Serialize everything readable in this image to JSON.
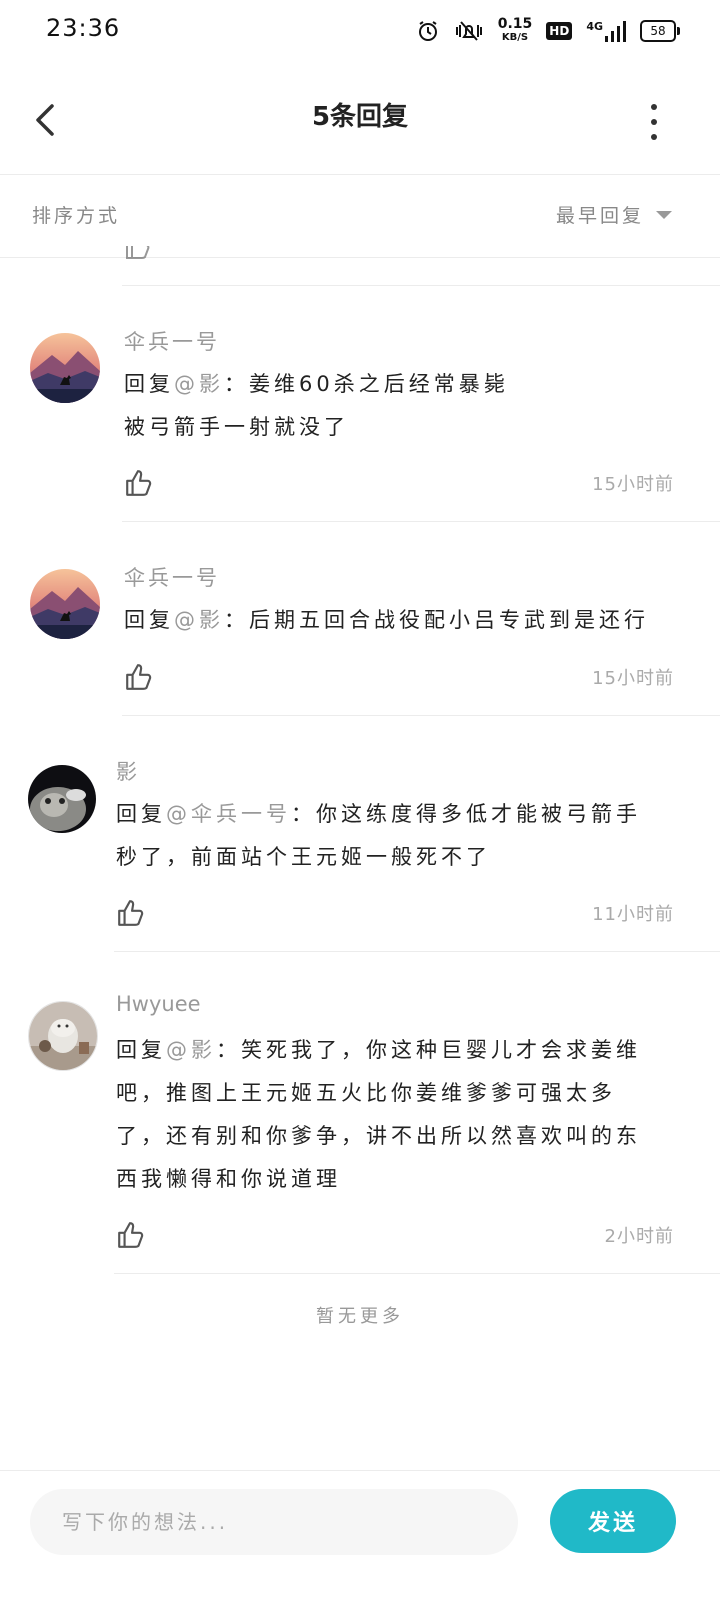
{
  "status": {
    "time": "23:36",
    "net_speed_value": "0.15",
    "net_speed_unit": "KB/S",
    "hd": "HD",
    "network": "4G",
    "battery": "58"
  },
  "header": {
    "title": "5条回复"
  },
  "sort": {
    "label": "排序方式",
    "value": "最早回复"
  },
  "replies": [
    {
      "user": "伞兵一号",
      "mention": "@影",
      "prefix": "回复",
      "text_line1": "：姜维60杀之后经常暴毙",
      "text_line2": "被弓箭手一射就没了",
      "time": "15小时前",
      "avatar": "landscape-wolf"
    },
    {
      "user": "伞兵一号",
      "mention": "@影",
      "prefix": "回复",
      "text_line1": "：后期五回合战役配小吕专武到是还行",
      "time": "15小时前",
      "avatar": "landscape-wolf"
    },
    {
      "user": "影",
      "mention": "@伞兵一号",
      "prefix": "回复",
      "text_line1": "：你这练度得多低才能被弓箭手",
      "text_line2": "秒了，前面站个王元姬一般死不了",
      "time": "11小时前",
      "avatar": "dark-cat"
    },
    {
      "user": "Hwyuee",
      "mention": "@影",
      "prefix": "回复",
      "text_line1": "：笑死我了，你这种巨婴儿才会求姜维",
      "text_line2": "吧，推图上王元姬五火比你姜维爹爹可强太多",
      "text_line3": "了，还有别和你爹争，讲不出所以然喜欢叫的东",
      "text_line4": "西我懒得和你说道理",
      "time": "2小时前",
      "avatar": "moomin"
    }
  ],
  "footer_note": "暂无更多",
  "compose": {
    "placeholder": "写下你的想法...",
    "send_label": "发送"
  },
  "colors": {
    "accent": "#20b9c8",
    "muted_text": "#999999",
    "divider": "#ececec"
  }
}
